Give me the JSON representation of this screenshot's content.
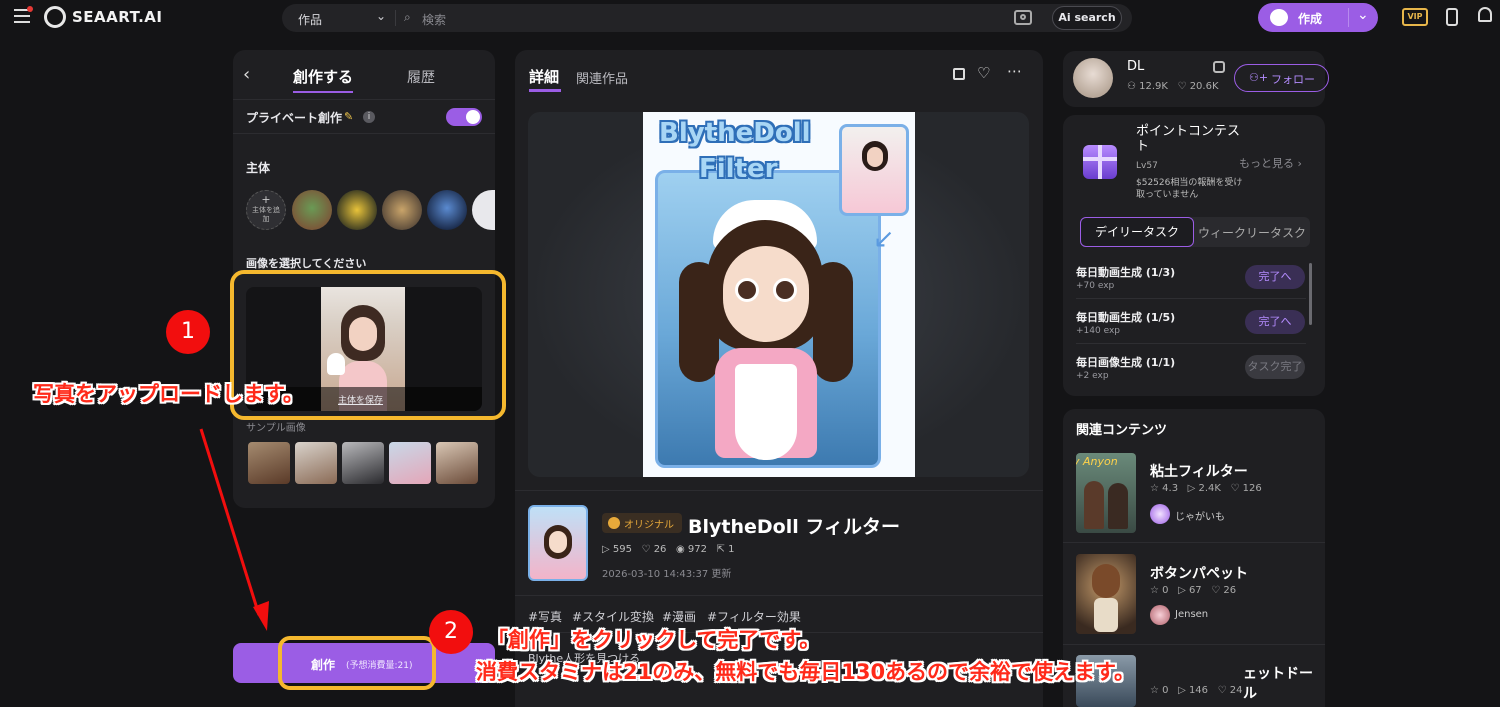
{
  "header": {
    "logo_text": "SEAART.AI",
    "search_category": "作品",
    "search_placeholder": "検索",
    "ai_search_label": "Ai search",
    "create_label": "作成"
  },
  "left_panel": {
    "tab_create": "創作する",
    "tab_history": "履歴",
    "private_label": "プライベート創作",
    "subject_heading": "主体",
    "add_subject_label": "主体を追加",
    "select_image_heading": "画像を選択してください",
    "save_subject_link": "主体を保存",
    "sample_heading": "サンプル画像",
    "create_button_label": "創作",
    "create_button_cost": "(予想消費量:21)"
  },
  "center": {
    "tab_detail": "詳細",
    "tab_related": "関連作品",
    "preview_title_line1": "BlytheDoll",
    "preview_title_line2": "Filter",
    "badge_original": "オリジナル",
    "title": "BlytheDoll フィルター",
    "stats": {
      "plays": "595",
      "likes": "26",
      "views": "972",
      "shares": "1"
    },
    "updated": "2026-03-10 14:43:37 更新",
    "tags": [
      "#写真",
      "#スタイル変換",
      "#漫画",
      "#フィルター効果"
    ],
    "description": "Blythe人形を見つける"
  },
  "right": {
    "user_name": "DL",
    "followers": "12.9K",
    "likes": "20.6K",
    "follow_label": "フォロー",
    "contest_title": "ポイントコンテスト",
    "contest_level": "Lv57",
    "contest_reward": "$52526相当の報酬を受け取っていません",
    "contest_more": "もっと見る",
    "tab_daily": "デイリータスク",
    "tab_weekly": "ウィークリータスク",
    "tasks": [
      {
        "name": "毎日動画生成 (1/3)",
        "exp": "+70 exp",
        "button": "完了へ"
      },
      {
        "name": "毎日動画生成 (1/5)",
        "exp": "+140 exp",
        "button": "完了へ"
      },
      {
        "name": "毎日画像生成 (1/1)",
        "exp": "+2 exp",
        "button": "タスク完了"
      }
    ],
    "related_heading": "関連コンテンツ",
    "related": [
      {
        "title": "粘土フィルター",
        "rating": "4.3",
        "plays": "2.4K",
        "likes": "126",
        "author": "じゃがいも",
        "thumb_text": "y Anyon"
      },
      {
        "title": "ボタンパペット",
        "rating": "0",
        "plays": "67",
        "likes": "26",
        "author": "Jensen"
      },
      {
        "title": "ェットドール",
        "rating": "0",
        "plays": "146",
        "likes": "24"
      }
    ]
  },
  "annotations": {
    "step1_number": "1",
    "step1_text": "写真をアップロードします。",
    "step2_number": "2",
    "step2_line1": "「創作」をクリックして完了です。",
    "step2_line2": "消費スタミナは21のみ、無料でも毎日130あるので余裕で使えます。"
  },
  "colors": {
    "accent": "#9b5de5",
    "annotation_red": "#f20e0e",
    "highlight_yellow": "#f5b82e",
    "background": "#141416"
  }
}
